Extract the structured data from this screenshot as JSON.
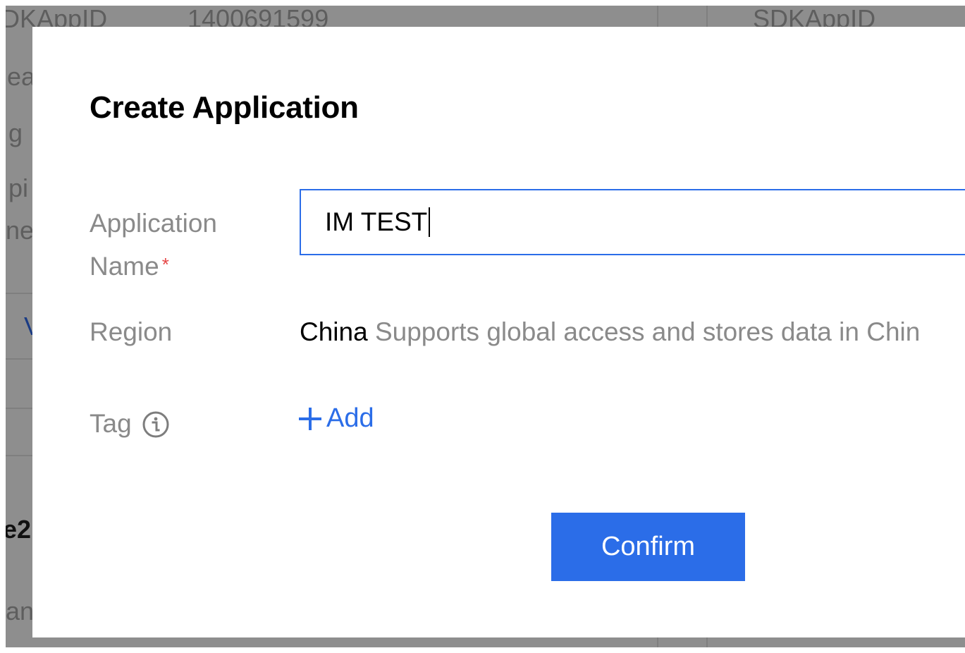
{
  "background": {
    "sdkappid_label_left": "SDKAppID",
    "sdkappid_value": "1400691599",
    "sdkappid_label_right": "SDKAppID",
    "fragments": [
      "ea",
      "g",
      "pi",
      "ne",
      "V",
      "e2",
      "an"
    ]
  },
  "dialog": {
    "title": "Create Application",
    "app_name_label_line1": "Application",
    "app_name_label_line2": "Name",
    "required_mark": "*",
    "app_name_value": "IM TEST",
    "region_label": "Region",
    "region_value": "China",
    "region_description": "Supports global access and stores data in Chin",
    "tag_label": "Tag",
    "tag_icon": "info-icon",
    "add_label": "Add",
    "add_icon": "plus-icon",
    "confirm_label": "Confirm"
  },
  "colors": {
    "accent": "#2b6de8",
    "required": "#e54545",
    "overlay": "#8e8e8e"
  }
}
